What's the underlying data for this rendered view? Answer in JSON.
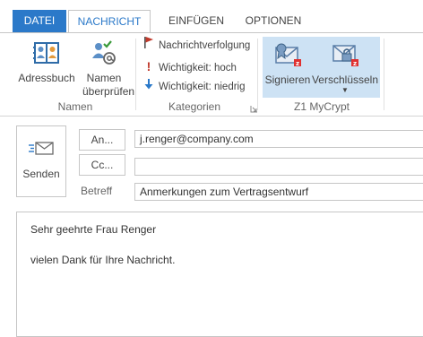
{
  "tabs": {
    "datei": "DATEI",
    "nachricht": "NACHRICHT",
    "einfuegen": "EINFÜGEN",
    "optionen": "OPTIONEN"
  },
  "ribbon": {
    "names_group": {
      "label": "Namen",
      "adressbuch": "Adressbuch",
      "namen_line1": "Namen",
      "namen_line2": "überprüfen"
    },
    "categories_group": {
      "label": "Kategorien",
      "nachrichtverfolgung": "Nachrichtverfolgung",
      "wichtigkeit_hoch": "Wichtigkeit: hoch",
      "wichtigkeit_niedrig": "Wichtigkeit: niedrig"
    },
    "mycrypt_group": {
      "label": "Z1 MyCrypt",
      "signieren": "Signieren",
      "verschluesseln": "Verschlüsseln"
    }
  },
  "compose": {
    "senden": "Senden",
    "an_button": "An...",
    "cc_button": "Cc...",
    "betreff_label": "Betreff",
    "to_value": "j.renger@company.com",
    "cc_value": "",
    "subject_value": "Anmerkungen zum Vertragsentwurf"
  },
  "message_body": {
    "line1": "Sehr geehrte Frau Renger",
    "line2": "vielen Dank für Ihre Nachricht."
  },
  "colors": {
    "accent": "#2b79c9",
    "mycrypt_highlight": "#cde2f4",
    "importance_high": "#c0392b",
    "importance_low": "#2b79c9"
  }
}
